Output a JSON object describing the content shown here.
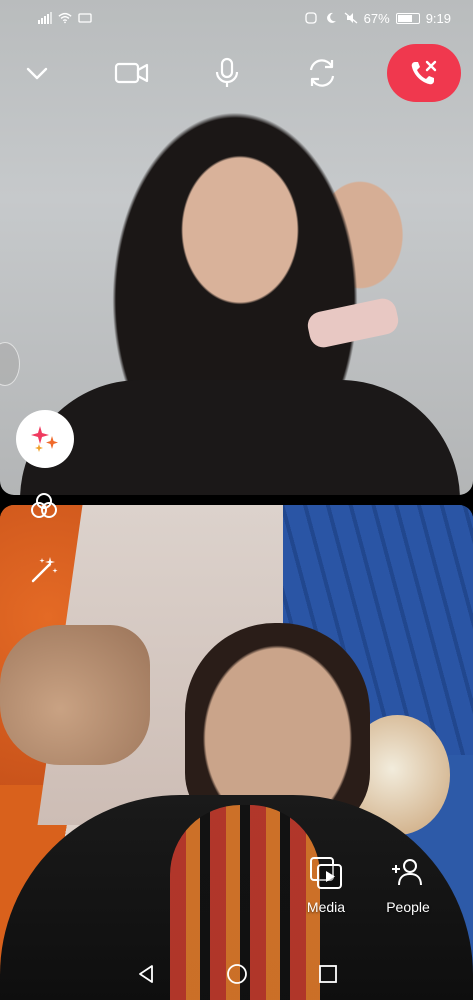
{
  "status_bar": {
    "battery": "67%",
    "time": "9:19",
    "icons": [
      "signal-icon",
      "wifi-icon",
      "cast-icon",
      "nfc-icon",
      "moon-icon",
      "mute-icon",
      "battery-icon"
    ]
  },
  "controls": {
    "icons": [
      "chevron-down-icon",
      "video-camera-icon",
      "microphone-icon",
      "switch-camera-icon",
      "end-call-icon"
    ],
    "end_call_color": "#f0384e"
  },
  "side_tools": [
    "effects-sparkle-icon",
    "filters-icon",
    "magic-wand-icon"
  ],
  "actions": [
    {
      "label": "Media",
      "icon": "media-icon"
    },
    {
      "label": "People",
      "icon": "add-person-icon"
    }
  ],
  "nav_bar": [
    "back-icon",
    "home-icon",
    "recents-icon"
  ]
}
